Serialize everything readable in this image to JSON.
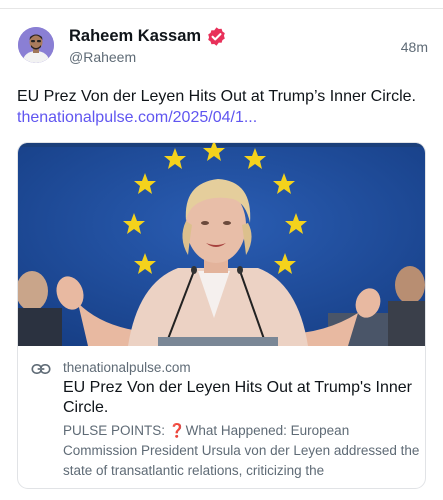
{
  "author": {
    "display_name": "Raheem Kassam",
    "handle": "@Raheem",
    "verified": true,
    "timestamp": "48m",
    "avatar_icon": "profile-photo"
  },
  "post": {
    "text": "EU Prez Von der Leyen Hits Out at Trump’s Inner Circle. ",
    "link_text": "thenationalpulse.com/2025/04/1...",
    "link_color": "#6056f0"
  },
  "card": {
    "domain": "thenationalpulse.com",
    "title": "EU Prez Von der Leyen Hits Out at Trump's Inner Circle.",
    "description": "PULSE POINTS: ❓What Happened: European Commission President Ursula von der Leyen addressed the state of transatlantic relations, criticizing the",
    "link_icon": "link-icon"
  },
  "colors": {
    "accent": "#6056f0",
    "verified_badge": "#e8315a",
    "eu_blue": "#1d4fa0",
    "eu_star": "#f4d21c"
  }
}
